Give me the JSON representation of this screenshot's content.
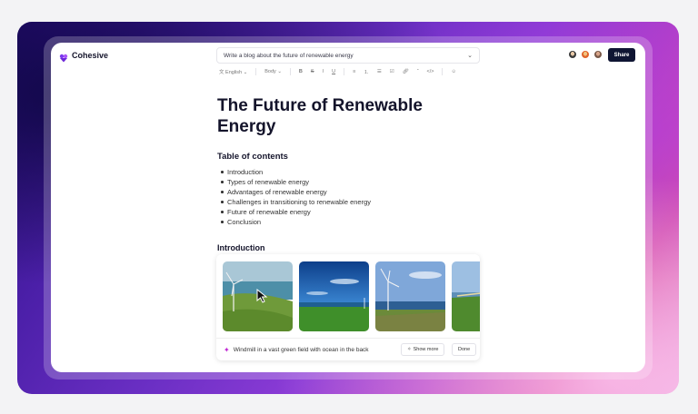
{
  "header": {
    "brand_name": "Cohesive",
    "prompt_text": "Write a blog about the future of renewable energy",
    "share_label": "Share"
  },
  "toolbar": {
    "language": "English",
    "style": "Body",
    "bold": "B",
    "strike": "S",
    "italic": "I",
    "underline": "U",
    "link_code": "</>"
  },
  "document": {
    "title": "The Future of Renewable Energy",
    "toc_heading": "Table of contents",
    "toc_items": [
      "Introduction",
      "Types of renewable energy",
      "Advantages of renewable energy",
      "Challenges in transitioning to renewable energy",
      "Future of renewable energy",
      "Conclusion"
    ],
    "intro_heading": "Introduction"
  },
  "gallery": {
    "caption": "Windmill in a vast green field with ocean in the back",
    "show_more_label": "Show more",
    "done_label": "Done"
  },
  "colors": {
    "brand_dark": "#0f1533",
    "accent_magenta": "#c026d3",
    "backdrop_purple": "#6b2fc4"
  }
}
